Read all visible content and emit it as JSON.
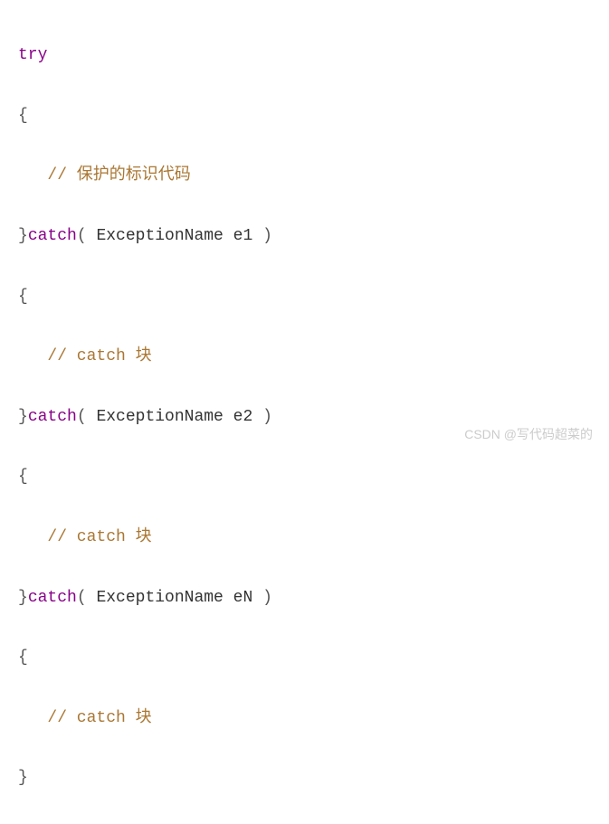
{
  "code": {
    "try_kw": "try",
    "open_brace_1": "{",
    "indent": "   ",
    "comment_1": "// 保护的标识代码",
    "close_brace_1": "}",
    "catch_kw_1": "catch",
    "paren_open_1": "( ",
    "exc_type_1": "ExceptionName",
    "exc_var_1": " e1",
    "paren_close_1": " )",
    "open_brace_2": "{",
    "comment_2": "// catch 块",
    "close_brace_2": "}",
    "catch_kw_2": "catch",
    "paren_open_2": "( ",
    "exc_type_2": "ExceptionName",
    "exc_var_2": " e2",
    "paren_close_2": " )",
    "open_brace_3": "{",
    "comment_3": "// catch 块",
    "close_brace_3": "}",
    "catch_kw_3": "catch",
    "paren_open_3": "( ",
    "exc_type_3": "ExceptionName",
    "exc_var_3": " eN",
    "paren_close_3": " )",
    "open_brace_4": "{",
    "comment_4": "// catch 块",
    "close_brace_4": "}"
  },
  "watermark": "CSDN @写代码超菜的"
}
